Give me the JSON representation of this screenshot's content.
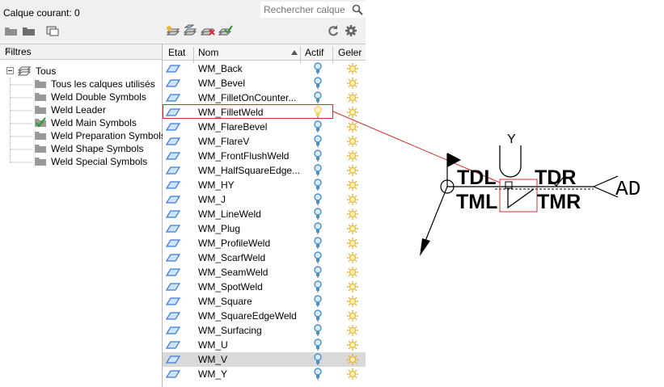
{
  "header": {
    "current_layer_label": "Calque courant: 0",
    "search_placeholder": "Rechercher calque"
  },
  "toolbar": {
    "left_icons": [
      "new-property-filter-icon",
      "new-group-filter-icon",
      "layer-states-manager-icon"
    ],
    "right_icons": [
      "new-layer-icon",
      "new-layer-vp-frozen-icon",
      "delete-layer-icon",
      "set-current-icon",
      "refresh-icon",
      "settings-icon"
    ]
  },
  "filters": {
    "header": "Filtres",
    "root": "Tous",
    "items": [
      "Tous les calques utilisés",
      "Weld Double Symbols",
      "Weld Leader",
      "Weld Main Symbols",
      "Weld Preparation Symbols",
      "Weld Shape Symbols",
      "Weld Special Symbols"
    ],
    "active_item": "Weld Main Symbols"
  },
  "layers": {
    "columns": [
      "Etat",
      "Nom",
      "Actif",
      "Geler"
    ],
    "sorted_column": "Nom",
    "rows": [
      "WM_Back",
      "WM_Bevel",
      "WM_FilletOnCounter...",
      "WM_FilletWeld",
      "WM_FlareBevel",
      "WM_FlareV",
      "WM_FrontFlushWeld",
      "WM_HalfSquareEdge...",
      "WM_HY",
      "WM_J",
      "WM_LineWeld",
      "WM_Plug",
      "WM_ProfileWeld",
      "WM_ScarfWeld",
      "WM_SeamWeld",
      "WM_SpotWeld",
      "WM_Square",
      "WM_SquareEdgeWeld",
      "WM_Surfacing",
      "WM_U",
      "WM_V",
      "WM_Y"
    ],
    "highlighted_row": "WM_FilletWeld",
    "selected_row": "WM_V"
  },
  "drawing": {
    "labels": {
      "y": "Y",
      "tdl": "TDL",
      "tdr": "TDR",
      "tml": "TML",
      "tmr": "TMR",
      "ad": "AD"
    }
  },
  "colors": {
    "highlight": "#d23030",
    "layer_icon": "#3a7bd5",
    "bulb_on": "#4a90c8",
    "bulb_active": "#f2d35a",
    "sun": "#e6a81e"
  }
}
